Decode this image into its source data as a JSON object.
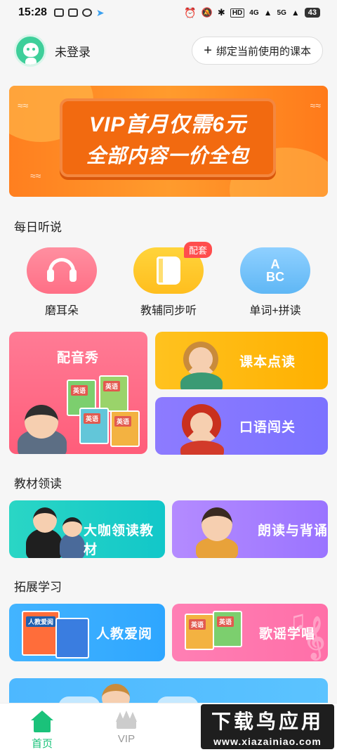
{
  "status_bar": {
    "time": "15:28",
    "network": "4G",
    "network2": "5G",
    "hd": "HD",
    "battery": "43"
  },
  "header": {
    "login_text": "未登录",
    "bind_button": "绑定当前使用的课本",
    "plus": "+"
  },
  "banner": {
    "line1": "VIP首月仅需6元",
    "line2": "全部内容一价全包"
  },
  "daily": {
    "title": "每日听说",
    "items": [
      {
        "label": "磨耳朵",
        "icon": "headphones-icon"
      },
      {
        "label": "教辅同步听",
        "icon": "book-icon",
        "badge": "配套"
      },
      {
        "label": "单词+拼读",
        "icon": "abc-icon",
        "icon_text": [
          "A",
          "BC"
        ]
      }
    ]
  },
  "cards_top": {
    "peiyin": "配音秀",
    "kebendian": "课本点读",
    "kouyu": "口语闯关",
    "book_label": "英语"
  },
  "textbook": {
    "title": "教材领读",
    "daka": "大咖领读教材",
    "langdu": "朗读与背诵"
  },
  "expand": {
    "title": "拓展学习",
    "renjiao": "人教爱阅",
    "geyao": "歌谣学唱",
    "book_label": "人教爱阅",
    "book_label2": "英语"
  },
  "bottom_nav": [
    {
      "label": "首页",
      "icon": "home-icon",
      "active": true
    },
    {
      "label": "VIP",
      "icon": "crown-icon",
      "active": false
    },
    {
      "label": "",
      "icon": "",
      "active": false
    },
    {
      "label": "",
      "icon": "",
      "active": false
    }
  ],
  "watermark": {
    "line1": "下载鸟应用",
    "line2": "www.xiazainiao.com"
  },
  "colors": {
    "accent": "#1ac27a",
    "banner": "#ff7f1f",
    "badge": "#ff4d4d"
  }
}
